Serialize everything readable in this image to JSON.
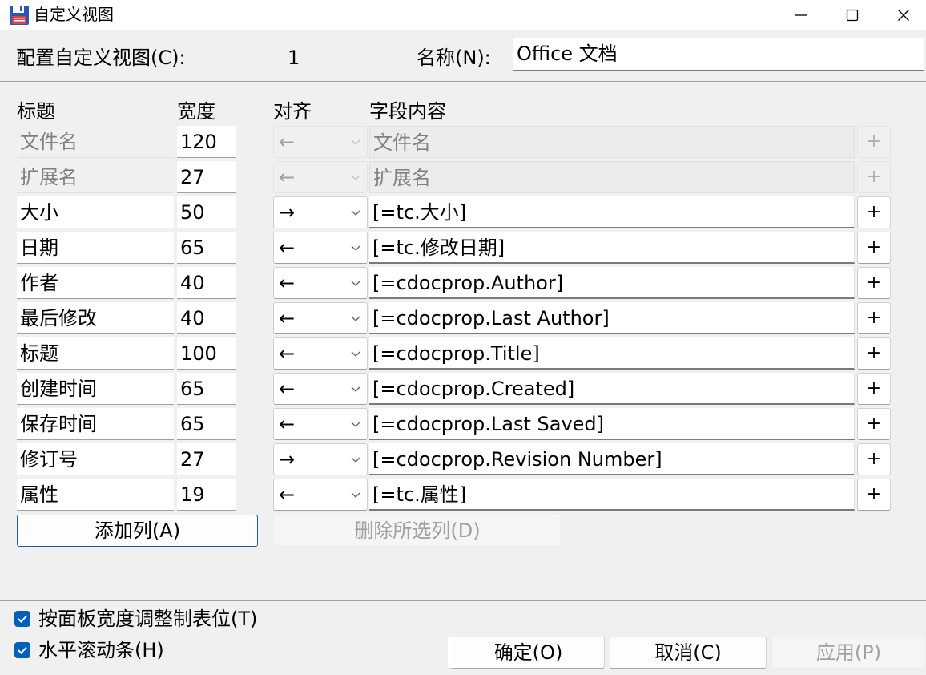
{
  "window": {
    "title": "自定义视图"
  },
  "config": {
    "label": "配置自定义视图(C):",
    "number": "1",
    "name_label": "名称(N):",
    "name_value": "Office 文档"
  },
  "headers": {
    "title": "标题",
    "width": "宽度",
    "align": "对齐",
    "field": "字段内容"
  },
  "rows": [
    {
      "title": "文件名",
      "width": "120",
      "align": "←",
      "field": "文件名",
      "disabled": true
    },
    {
      "title": "扩展名",
      "width": "27",
      "align": "←",
      "field": "扩展名",
      "disabled": true
    },
    {
      "title": "大小",
      "width": "50",
      "align": "→",
      "field": "[=tc.大小]",
      "disabled": false
    },
    {
      "title": "日期",
      "width": "65",
      "align": "←",
      "field": "[=tc.修改日期]",
      "disabled": false
    },
    {
      "title": "作者",
      "width": "40",
      "align": "←",
      "field": "[=cdocprop.Author]",
      "disabled": false
    },
    {
      "title": "最后修改",
      "width": "40",
      "align": "←",
      "field": "[=cdocprop.Last Author]",
      "disabled": false
    },
    {
      "title": "标题",
      "width": "100",
      "align": "←",
      "field": "[=cdocprop.Title]",
      "disabled": false
    },
    {
      "title": "创建时间",
      "width": "65",
      "align": "←",
      "field": "[=cdocprop.Created]",
      "disabled": false
    },
    {
      "title": "保存时间",
      "width": "65",
      "align": "←",
      "field": "[=cdocprop.Last Saved]",
      "disabled": false
    },
    {
      "title": "修订号",
      "width": "27",
      "align": "→",
      "field": "[=cdocprop.Revision Number]",
      "disabled": false
    },
    {
      "title": "属性",
      "width": "19",
      "align": "←",
      "field": "[=tc.属性]",
      "disabled": false
    }
  ],
  "plus_label": "+",
  "buttons": {
    "add_column": "添加列(A)",
    "delete_column": "删除所选列(D)",
    "ok": "确定(O)",
    "cancel": "取消(C)",
    "apply": "应用(P)"
  },
  "checkboxes": [
    {
      "label": "按面板宽度调整制表位(T)",
      "checked": true
    },
    {
      "label": "水平滚动条(H)",
      "checked": true
    }
  ],
  "colors": {
    "accent": "#005fb8",
    "disabled_text": "#808080",
    "window_bg": "#f0f0f0"
  }
}
